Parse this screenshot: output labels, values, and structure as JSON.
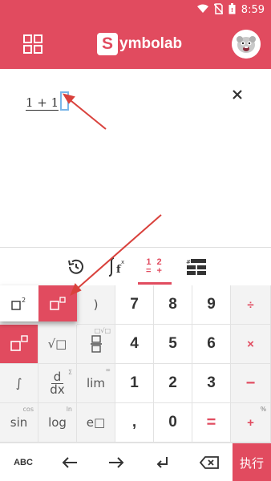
{
  "status_bar": {
    "time": "8:59",
    "icons": [
      "wifi-icon",
      "no-sim-icon",
      "battery-icon"
    ]
  },
  "app_bar": {
    "logo_letter": "S",
    "logo_rest": "ymbolab",
    "menu_icon": "grid-icon",
    "avatar_icon": "avatar-icon"
  },
  "editor": {
    "expression": "1 + 1"
  },
  "tabs": [
    {
      "name": "history-icon"
    },
    {
      "name": "function-icon",
      "text": "∫f(x)"
    },
    {
      "name": "numbers-tab",
      "line1": "1 2",
      "line2": "= +"
    },
    {
      "name": "keyboard-layout-icon"
    }
  ],
  "popup": {
    "left_label": "□²",
    "right_label": "□□"
  },
  "keys": {
    "row1": {
      "paren": ")",
      "k7": "7",
      "k8": "8",
      "k9": "9",
      "div": "÷"
    },
    "row2": {
      "sqrt": "√□",
      "frac": "□/□",
      "k4": "4",
      "k5": "5",
      "k6": "6",
      "mul": "×",
      "sqrt_sup": "□√□"
    },
    "row3": {
      "int": "∫",
      "deriv_top": "d",
      "deriv_bot": "dx",
      "lim": "lim",
      "k1": "1",
      "k2": "2",
      "k3": "3",
      "minus": "−",
      "deriv_sup": "Σ",
      "lim_sup": "∞"
    },
    "row4": {
      "sin": "sin",
      "log": "log",
      "exp": "e□",
      "dot": ",",
      "k0": "0",
      "eq": "=",
      "plus": "+",
      "sin_sup": "cos",
      "log_sup": "ln",
      "plus_sup": "%"
    }
  },
  "bottom_bar": {
    "abc": "ABC",
    "left": "←",
    "right": "→",
    "enter": "↲",
    "backspace": "⌫",
    "execute": "执行"
  },
  "colors": {
    "brand": "#e14b5f",
    "cursor": "#7ab6e8",
    "arrow": "#d9413c"
  }
}
